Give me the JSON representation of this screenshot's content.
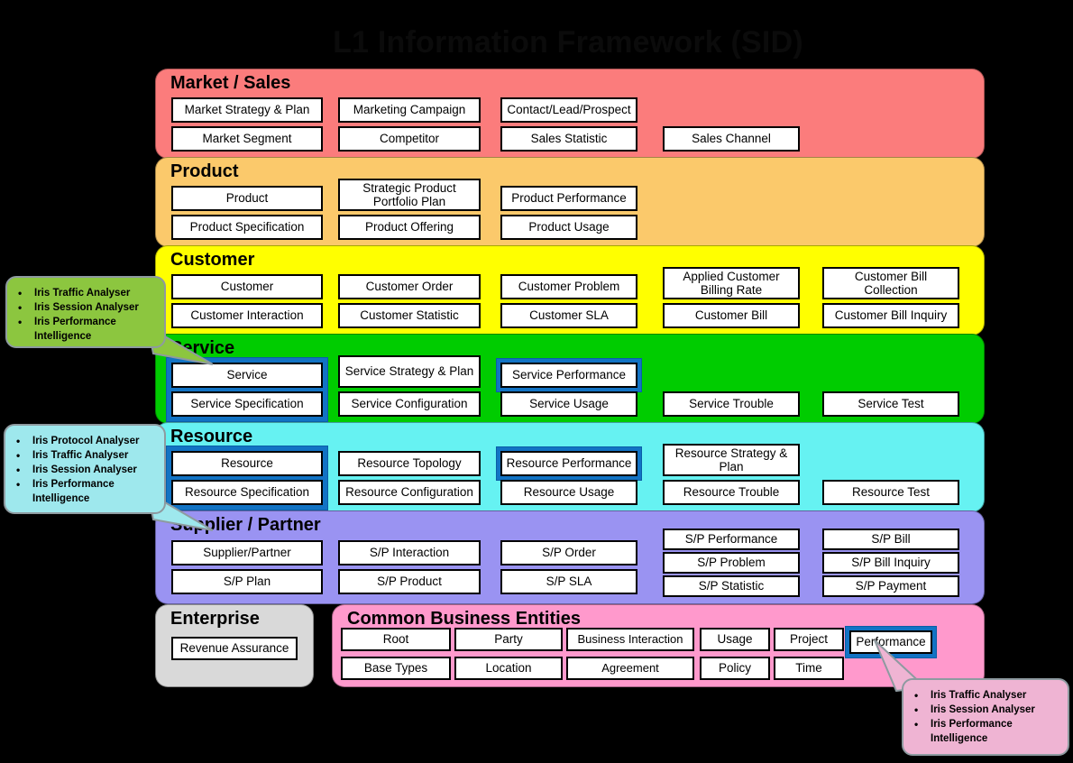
{
  "title": "L1 Information Framework (SID)",
  "colors": {
    "background": "#000000",
    "market_sales": "#FB7C7C",
    "product": "#FBC96B",
    "customer": "#FFFF00",
    "service": "#00CC00",
    "resource": "#66F2F2",
    "supplier_partner": "#9A93F2",
    "common_business_entities": "#FF99CC",
    "enterprise": "#D9D9D9",
    "highlight_blue": "#1273C4",
    "callout_green": "#8CC63F",
    "callout_cyan": "#9EE8ED",
    "callout_pink": "#EFB4D3",
    "box_fill": "#FFFFFF",
    "box_border": "#000000"
  },
  "layers": [
    {
      "id": "market-sales",
      "title": "Market / Sales",
      "color_key": "market_sales",
      "columns": [
        {
          "boxes": [
            {
              "label": "Market Strategy & Plan"
            },
            {
              "label": "Market Segment"
            }
          ]
        },
        {
          "boxes": [
            {
              "label": "Marketing Campaign"
            },
            {
              "label": "Competitor"
            }
          ]
        },
        {
          "boxes": [
            {
              "label": "Contact/Lead/Prospect"
            },
            {
              "label": "Sales Statistic"
            }
          ]
        },
        {
          "boxes": [
            {
              "label": ""
            },
            {
              "label": "Sales Channel"
            }
          ]
        }
      ]
    },
    {
      "id": "product",
      "title": "Product",
      "color_key": "product",
      "columns": [
        {
          "boxes": [
            {
              "label": "Product"
            },
            {
              "label": "Product Specification"
            }
          ]
        },
        {
          "boxes": [
            {
              "label": "Strategic Product Portfolio Plan"
            },
            {
              "label": "Product Offering"
            }
          ]
        },
        {
          "boxes": [
            {
              "label": "Product Performance"
            },
            {
              "label": "Product Usage"
            }
          ]
        }
      ]
    },
    {
      "id": "customer",
      "title": "Customer",
      "color_key": "customer",
      "columns": [
        {
          "boxes": [
            {
              "label": "Customer"
            },
            {
              "label": "Customer Interaction"
            }
          ]
        },
        {
          "boxes": [
            {
              "label": "Customer Order"
            },
            {
              "label": "Customer Statistic"
            }
          ]
        },
        {
          "boxes": [
            {
              "label": "Customer Problem"
            },
            {
              "label": "Customer SLA"
            }
          ]
        },
        {
          "boxes": [
            {
              "label": "Applied Customer Billing Rate"
            },
            {
              "label": "Customer Bill"
            }
          ]
        },
        {
          "boxes": [
            {
              "label": "Customer Bill Collection"
            },
            {
              "label": "Customer Bill Inquiry"
            }
          ]
        }
      ]
    },
    {
      "id": "service",
      "title": "Service",
      "color_key": "service",
      "columns": [
        {
          "highlighted": true,
          "boxes": [
            {
              "label": "Service"
            },
            {
              "label": "Service Specification"
            }
          ]
        },
        {
          "boxes": [
            {
              "label": "Service Strategy & Plan"
            },
            {
              "label": "Service Configuration"
            }
          ]
        },
        {
          "boxes": [
            {
              "label": "Service Performance",
              "highlighted": true
            },
            {
              "label": "Service Usage"
            }
          ]
        },
        {
          "boxes": [
            {
              "label": ""
            },
            {
              "label": "Service Trouble"
            }
          ]
        },
        {
          "boxes": [
            {
              "label": ""
            },
            {
              "label": "Service Test"
            }
          ]
        }
      ]
    },
    {
      "id": "resource",
      "title": "Resource",
      "color_key": "resource",
      "columns": [
        {
          "highlighted": true,
          "boxes": [
            {
              "label": "Resource"
            },
            {
              "label": "Resource Specification"
            }
          ]
        },
        {
          "boxes": [
            {
              "label": "Resource Topology"
            },
            {
              "label": "Resource Configuration"
            }
          ]
        },
        {
          "boxes": [
            {
              "label": "Resource Performance",
              "highlighted": true
            },
            {
              "label": "Resource Usage"
            }
          ]
        },
        {
          "boxes": [
            {
              "label": "Resource Strategy & Plan"
            },
            {
              "label": "Resource Trouble"
            }
          ]
        },
        {
          "boxes": [
            {
              "label": ""
            },
            {
              "label": "Resource Test"
            }
          ]
        }
      ]
    },
    {
      "id": "supplier-partner",
      "title": "Supplier / Partner",
      "color_key": "supplier_partner",
      "columns": [
        {
          "boxes": [
            {
              "label": "Supplier/Partner"
            },
            {
              "label": "S/P Plan"
            }
          ]
        },
        {
          "boxes": [
            {
              "label": "S/P Interaction"
            },
            {
              "label": "S/P Product"
            }
          ]
        },
        {
          "boxes": [
            {
              "label": "S/P Order"
            },
            {
              "label": "S/P SLA"
            }
          ]
        },
        {
          "triple": true,
          "boxes": [
            {
              "label": "S/P Performance"
            },
            {
              "label": "S/P Problem"
            },
            {
              "label": "S/P Statistic"
            }
          ]
        },
        {
          "triple": true,
          "boxes": [
            {
              "label": "S/P Bill"
            },
            {
              "label": "S/P Bill Inquiry"
            },
            {
              "label": "S/P Payment"
            }
          ]
        }
      ]
    }
  ],
  "enterprise": {
    "title": "Enterprise",
    "boxes": [
      {
        "label": "Revenue Assurance"
      }
    ]
  },
  "common_business_entities": {
    "title": "Common Business Entities",
    "columns": [
      {
        "boxes": [
          {
            "label": "Root"
          },
          {
            "label": "Base Types"
          }
        ]
      },
      {
        "boxes": [
          {
            "label": "Party"
          },
          {
            "label": "Location"
          }
        ]
      },
      {
        "boxes": [
          {
            "label": "Business Interaction"
          },
          {
            "label": "Agreement"
          }
        ]
      },
      {
        "boxes": [
          {
            "label": "Usage"
          },
          {
            "label": "Policy"
          }
        ]
      },
      {
        "boxes": [
          {
            "label": "Project"
          },
          {
            "label": "Time"
          }
        ]
      },
      {
        "boxes": [
          {
            "label": "Performance",
            "highlighted": true
          }
        ]
      }
    ]
  },
  "callouts": [
    {
      "id": "callout-service",
      "color_key": "callout_green",
      "items": [
        "Iris Traffic Analyser",
        "Iris Session Analyser",
        "Iris Performance Intelligence"
      ]
    },
    {
      "id": "callout-resource",
      "color_key": "callout_cyan",
      "items": [
        "Iris Protocol Analyser",
        "Iris Traffic Analyser",
        "Iris Session Analyser",
        "Iris Performance Intelligence"
      ]
    },
    {
      "id": "callout-performance",
      "color_key": "callout_pink",
      "items": [
        "Iris Traffic Analyser",
        "Iris Session Analyser",
        "Iris Performance Intelligence"
      ]
    }
  ]
}
